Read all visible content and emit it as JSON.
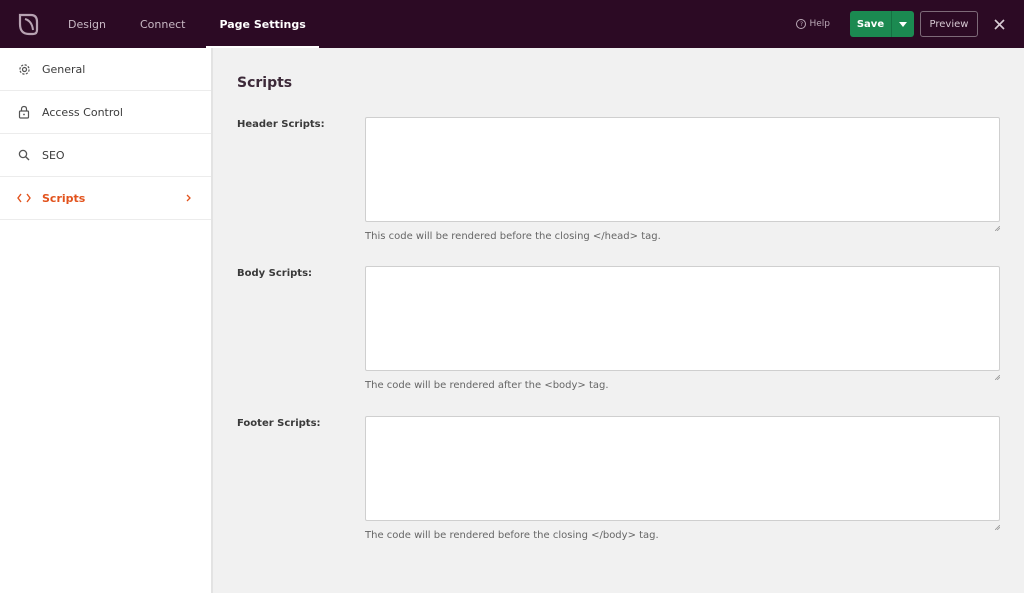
{
  "topbar": {
    "tabs": [
      {
        "label": "Design"
      },
      {
        "label": "Connect"
      },
      {
        "label": "Page Settings"
      }
    ],
    "help_label": "Help",
    "save_label": "Save",
    "preview_label": "Preview",
    "accent_color": "#1b8a51",
    "background_color": "#2c0a24"
  },
  "sidebar": {
    "items": [
      {
        "label": "General",
        "icon": "gear-icon"
      },
      {
        "label": "Access Control",
        "icon": "lock-icon"
      },
      {
        "label": "SEO",
        "icon": "search-icon"
      },
      {
        "label": "Scripts",
        "icon": "code-icon",
        "active": true
      }
    ],
    "active_color": "#e2531d"
  },
  "main": {
    "title": "Scripts",
    "fields": [
      {
        "label": "Header Scripts:",
        "value": "",
        "hint": "This code will be rendered before the closing </head> tag."
      },
      {
        "label": "Body Scripts:",
        "value": "",
        "hint": "The code will be rendered after the <body> tag."
      },
      {
        "label": "Footer Scripts:",
        "value": "",
        "hint": "The code will be rendered before the closing </body> tag."
      }
    ]
  }
}
